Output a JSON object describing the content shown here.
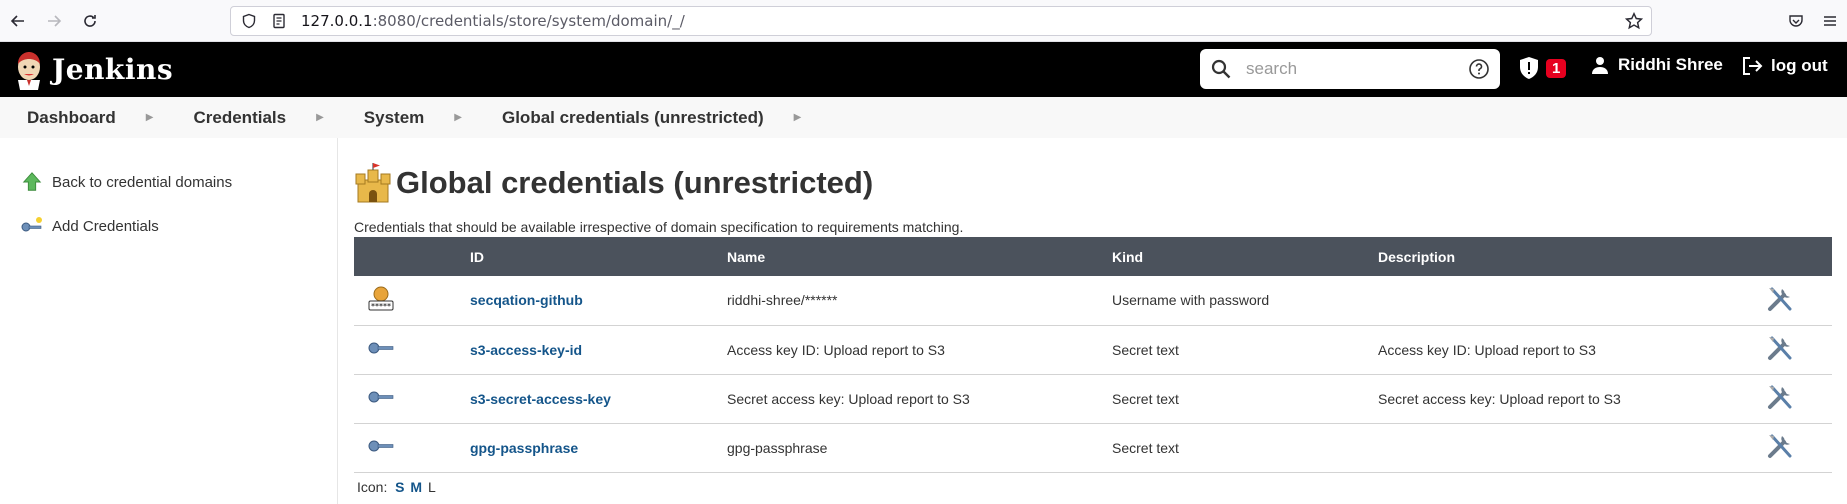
{
  "browser": {
    "url_host": "127.0.0.1",
    "url_rest": ":8080/credentials/store/system/domain/_/"
  },
  "header": {
    "brand": "Jenkins",
    "search_placeholder": "search",
    "alert_count": "1",
    "user_name": "Riddhi Shree",
    "logout_label": "log out"
  },
  "breadcrumb": [
    {
      "label": "Dashboard"
    },
    {
      "label": "Credentials"
    },
    {
      "label": "System"
    },
    {
      "label": "Global credentials (unrestricted)"
    }
  ],
  "sidebar": {
    "items": [
      {
        "label": "Back to credential domains",
        "icon": "up-arrow-icon"
      },
      {
        "label": "Add Credentials",
        "icon": "key-icon"
      }
    ]
  },
  "main": {
    "title": "Global credentials (unrestricted)",
    "description": "Credentials that should be available irrespective of domain specification to requirements matching.",
    "table": {
      "headers": [
        "",
        "ID",
        "Name",
        "Kind",
        "Description",
        ""
      ],
      "rows": [
        {
          "icon": "user-password-icon",
          "id": "secqation-github",
          "name": "riddhi-shree/******",
          "kind": "Username with password",
          "description": ""
        },
        {
          "icon": "key-icon",
          "id": "s3-access-key-id",
          "name": "Access key ID: Upload report to S3",
          "kind": "Secret text",
          "description": "Access key ID: Upload report to S3"
        },
        {
          "icon": "key-icon",
          "id": "s3-secret-access-key",
          "name": "Secret access key: Upload report to S3",
          "kind": "Secret text",
          "description": "Secret access key: Upload report to S3"
        },
        {
          "icon": "key-icon",
          "id": "gpg-passphrase",
          "name": "gpg-passphrase",
          "kind": "Secret text",
          "description": ""
        }
      ]
    },
    "icon_size": {
      "label": "Icon:",
      "options": [
        "S",
        "M",
        "L"
      ]
    }
  },
  "colors": {
    "header_bg": "#000000",
    "table_header_bg": "#4b525c",
    "link": "#14558a",
    "alert": "#e6001f"
  }
}
